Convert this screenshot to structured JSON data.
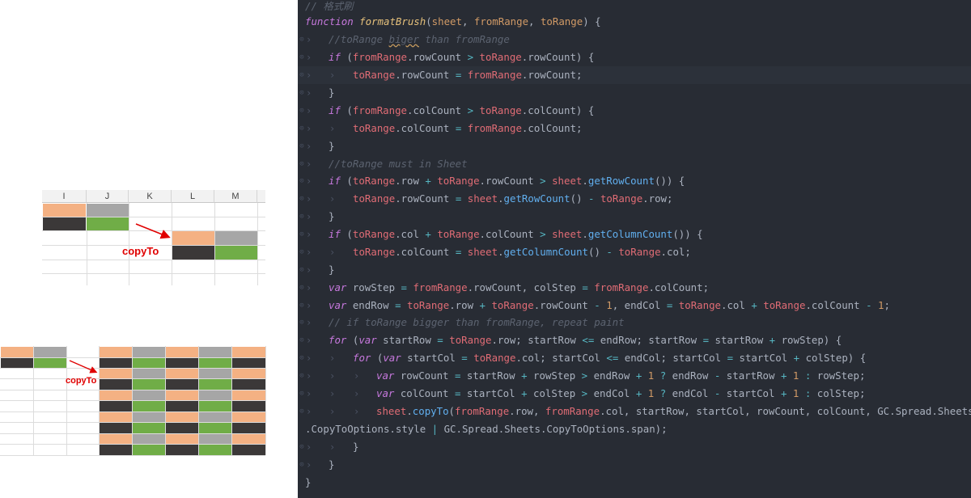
{
  "colors": {
    "orange": "#f4b183",
    "gray": "#a6a6a6",
    "dark": "#3b3838",
    "green": "#70ad47",
    "label_red": "#e00000",
    "editor_bg": "#282c34"
  },
  "illustration": {
    "top_grid": {
      "columns": [
        "I",
        "J",
        "K",
        "L",
        "M"
      ],
      "copy_label": "copyTo"
    },
    "bottom_grid": {
      "copy_label": "copyTo"
    }
  },
  "code": {
    "lines": [
      [
        {
          "t": "cm",
          "v": "// 格式刷"
        }
      ],
      [
        {
          "t": "kw",
          "v": "function "
        },
        {
          "t": "fn",
          "v": "formatBrush"
        },
        {
          "t": "pl",
          "v": "("
        },
        {
          "t": "prm",
          "v": "sheet"
        },
        {
          "t": "pl",
          "v": ", "
        },
        {
          "t": "prm",
          "v": "fromRange"
        },
        {
          "t": "pl",
          "v": ", "
        },
        {
          "t": "prm",
          "v": "toRange"
        },
        {
          "t": "pl",
          "v": ") {"
        }
      ],
      [
        {
          "t": "cm",
          "v": "//toRange "
        },
        {
          "t": "cmw",
          "v": "biger"
        },
        {
          "t": "cm",
          "v": " than fromRange"
        }
      ],
      [
        {
          "t": "kw",
          "v": "if "
        },
        {
          "t": "pl",
          "v": "("
        },
        {
          "t": "var",
          "v": "fromRange"
        },
        {
          "t": "pl",
          "v": ".rowCount "
        },
        {
          "t": "op",
          "v": ">"
        },
        {
          "t": "pl",
          "v": " "
        },
        {
          "t": "var",
          "v": "toRange"
        },
        {
          "t": "pl",
          "v": ".rowCount) {"
        }
      ],
      [
        {
          "t": "var",
          "v": "toRange"
        },
        {
          "t": "pl",
          "v": ".rowCount "
        },
        {
          "t": "op",
          "v": "="
        },
        {
          "t": "pl",
          "v": " "
        },
        {
          "t": "var",
          "v": "fromRange"
        },
        {
          "t": "pl",
          "v": ".rowCount;"
        }
      ],
      [
        {
          "t": "pl",
          "v": "}"
        }
      ],
      [
        {
          "t": "kw",
          "v": "if "
        },
        {
          "t": "pl",
          "v": "("
        },
        {
          "t": "var",
          "v": "fromRange"
        },
        {
          "t": "pl",
          "v": ".colCount "
        },
        {
          "t": "op",
          "v": ">"
        },
        {
          "t": "pl",
          "v": " "
        },
        {
          "t": "var",
          "v": "toRange"
        },
        {
          "t": "pl",
          "v": ".colCount) {"
        }
      ],
      [
        {
          "t": "var",
          "v": "toRange"
        },
        {
          "t": "pl",
          "v": ".colCount "
        },
        {
          "t": "op",
          "v": "="
        },
        {
          "t": "pl",
          "v": " "
        },
        {
          "t": "var",
          "v": "fromRange"
        },
        {
          "t": "pl",
          "v": ".colCount;"
        }
      ],
      [
        {
          "t": "pl",
          "v": "}"
        }
      ],
      [
        {
          "t": "cm",
          "v": "//toRange must in Sheet"
        }
      ],
      [
        {
          "t": "kw",
          "v": "if "
        },
        {
          "t": "pl",
          "v": "("
        },
        {
          "t": "var",
          "v": "toRange"
        },
        {
          "t": "pl",
          "v": ".row "
        },
        {
          "t": "op",
          "v": "+"
        },
        {
          "t": "pl",
          "v": " "
        },
        {
          "t": "var",
          "v": "toRange"
        },
        {
          "t": "pl",
          "v": ".rowCount "
        },
        {
          "t": "op",
          "v": ">"
        },
        {
          "t": "pl",
          "v": " "
        },
        {
          "t": "var",
          "v": "sheet"
        },
        {
          "t": "pl",
          "v": "."
        },
        {
          "t": "fnc",
          "v": "getRowCount"
        },
        {
          "t": "pl",
          "v": "()) {"
        }
      ],
      [
        {
          "t": "var",
          "v": "toRange"
        },
        {
          "t": "pl",
          "v": ".rowCount "
        },
        {
          "t": "op",
          "v": "="
        },
        {
          "t": "pl",
          "v": " "
        },
        {
          "t": "var",
          "v": "sheet"
        },
        {
          "t": "pl",
          "v": "."
        },
        {
          "t": "fnc",
          "v": "getRowCount"
        },
        {
          "t": "pl",
          "v": "() "
        },
        {
          "t": "op",
          "v": "-"
        },
        {
          "t": "pl",
          "v": " "
        },
        {
          "t": "var",
          "v": "toRange"
        },
        {
          "t": "pl",
          "v": ".row;"
        }
      ],
      [
        {
          "t": "pl",
          "v": "}"
        }
      ],
      [
        {
          "t": "kw",
          "v": "if "
        },
        {
          "t": "pl",
          "v": "("
        },
        {
          "t": "var",
          "v": "toRange"
        },
        {
          "t": "pl",
          "v": ".col "
        },
        {
          "t": "op",
          "v": "+"
        },
        {
          "t": "pl",
          "v": " "
        },
        {
          "t": "var",
          "v": "toRange"
        },
        {
          "t": "pl",
          "v": ".colCount "
        },
        {
          "t": "op",
          "v": ">"
        },
        {
          "t": "pl",
          "v": " "
        },
        {
          "t": "var",
          "v": "sheet"
        },
        {
          "t": "pl",
          "v": "."
        },
        {
          "t": "fnc",
          "v": "getColumnCount"
        },
        {
          "t": "pl",
          "v": "()) {"
        }
      ],
      [
        {
          "t": "var",
          "v": "toRange"
        },
        {
          "t": "pl",
          "v": ".colCount "
        },
        {
          "t": "op",
          "v": "="
        },
        {
          "t": "pl",
          "v": " "
        },
        {
          "t": "var",
          "v": "sheet"
        },
        {
          "t": "pl",
          "v": "."
        },
        {
          "t": "fnc",
          "v": "getColumnCount"
        },
        {
          "t": "pl",
          "v": "() "
        },
        {
          "t": "op",
          "v": "-"
        },
        {
          "t": "pl",
          "v": " "
        },
        {
          "t": "var",
          "v": "toRange"
        },
        {
          "t": "pl",
          "v": ".col;"
        }
      ],
      [
        {
          "t": "pl",
          "v": "}"
        }
      ],
      [
        {
          "t": "kw",
          "v": "var "
        },
        {
          "t": "pl",
          "v": "rowStep "
        },
        {
          "t": "op",
          "v": "="
        },
        {
          "t": "pl",
          "v": " "
        },
        {
          "t": "var",
          "v": "fromRange"
        },
        {
          "t": "pl",
          "v": ".rowCount, colStep "
        },
        {
          "t": "op",
          "v": "="
        },
        {
          "t": "pl",
          "v": " "
        },
        {
          "t": "var",
          "v": "fromRange"
        },
        {
          "t": "pl",
          "v": ".colCount;"
        }
      ],
      [
        {
          "t": "kw",
          "v": "var "
        },
        {
          "t": "pl",
          "v": "endRow "
        },
        {
          "t": "op",
          "v": "="
        },
        {
          "t": "pl",
          "v": " "
        },
        {
          "t": "var",
          "v": "toRange"
        },
        {
          "t": "pl",
          "v": ".row "
        },
        {
          "t": "op",
          "v": "+"
        },
        {
          "t": "pl",
          "v": " "
        },
        {
          "t": "var",
          "v": "toRange"
        },
        {
          "t": "pl",
          "v": ".rowCount "
        },
        {
          "t": "op",
          "v": "-"
        },
        {
          "t": "pl",
          "v": " "
        },
        {
          "t": "num",
          "v": "1"
        },
        {
          "t": "pl",
          "v": ", endCol "
        },
        {
          "t": "op",
          "v": "="
        },
        {
          "t": "pl",
          "v": " "
        },
        {
          "t": "var",
          "v": "toRange"
        },
        {
          "t": "pl",
          "v": ".col "
        },
        {
          "t": "op",
          "v": "+"
        },
        {
          "t": "pl",
          "v": " "
        },
        {
          "t": "var",
          "v": "toRange"
        },
        {
          "t": "pl",
          "v": ".colCount "
        },
        {
          "t": "op",
          "v": "-"
        },
        {
          "t": "pl",
          "v": " "
        },
        {
          "t": "num",
          "v": "1"
        },
        {
          "t": "pl",
          "v": ";"
        }
      ],
      [
        {
          "t": "cm",
          "v": "// if toRange bigger than fromRange, repeat paint"
        }
      ],
      [
        {
          "t": "kw",
          "v": "for "
        },
        {
          "t": "pl",
          "v": "("
        },
        {
          "t": "kw",
          "v": "var "
        },
        {
          "t": "pl",
          "v": "startRow "
        },
        {
          "t": "op",
          "v": "="
        },
        {
          "t": "pl",
          "v": " "
        },
        {
          "t": "var",
          "v": "toRange"
        },
        {
          "t": "pl",
          "v": ".row; startRow "
        },
        {
          "t": "op",
          "v": "<="
        },
        {
          "t": "pl",
          "v": " endRow; startRow "
        },
        {
          "t": "op",
          "v": "="
        },
        {
          "t": "pl",
          "v": " startRow "
        },
        {
          "t": "op",
          "v": "+"
        },
        {
          "t": "pl",
          "v": " rowStep) {"
        }
      ],
      [
        {
          "t": "kw",
          "v": "for "
        },
        {
          "t": "pl",
          "v": "("
        },
        {
          "t": "kw",
          "v": "var "
        },
        {
          "t": "pl",
          "v": "startCol "
        },
        {
          "t": "op",
          "v": "="
        },
        {
          "t": "pl",
          "v": " "
        },
        {
          "t": "var",
          "v": "toRange"
        },
        {
          "t": "pl",
          "v": ".col; startCol "
        },
        {
          "t": "op",
          "v": "<="
        },
        {
          "t": "pl",
          "v": " endCol; startCol "
        },
        {
          "t": "op",
          "v": "="
        },
        {
          "t": "pl",
          "v": " startCol "
        },
        {
          "t": "op",
          "v": "+"
        },
        {
          "t": "pl",
          "v": " colStep) {"
        }
      ],
      [
        {
          "t": "kw",
          "v": "var "
        },
        {
          "t": "pl",
          "v": "rowCount "
        },
        {
          "t": "op",
          "v": "="
        },
        {
          "t": "pl",
          "v": " startRow "
        },
        {
          "t": "op",
          "v": "+"
        },
        {
          "t": "pl",
          "v": " rowStep "
        },
        {
          "t": "op",
          "v": ">"
        },
        {
          "t": "pl",
          "v": " endRow "
        },
        {
          "t": "op",
          "v": "+"
        },
        {
          "t": "pl",
          "v": " "
        },
        {
          "t": "num",
          "v": "1"
        },
        {
          "t": "pl",
          "v": " "
        },
        {
          "t": "op",
          "v": "?"
        },
        {
          "t": "pl",
          "v": " endRow "
        },
        {
          "t": "op",
          "v": "-"
        },
        {
          "t": "pl",
          "v": " startRow "
        },
        {
          "t": "op",
          "v": "+"
        },
        {
          "t": "pl",
          "v": " "
        },
        {
          "t": "num",
          "v": "1"
        },
        {
          "t": "pl",
          "v": " "
        },
        {
          "t": "op",
          "v": ":"
        },
        {
          "t": "pl",
          "v": " rowStep;"
        }
      ],
      [
        {
          "t": "kw",
          "v": "var "
        },
        {
          "t": "pl",
          "v": "colCount "
        },
        {
          "t": "op",
          "v": "="
        },
        {
          "t": "pl",
          "v": " startCol "
        },
        {
          "t": "op",
          "v": "+"
        },
        {
          "t": "pl",
          "v": " colStep "
        },
        {
          "t": "op",
          "v": ">"
        },
        {
          "t": "pl",
          "v": " endCol "
        },
        {
          "t": "op",
          "v": "+"
        },
        {
          "t": "pl",
          "v": " "
        },
        {
          "t": "num",
          "v": "1"
        },
        {
          "t": "pl",
          "v": " "
        },
        {
          "t": "op",
          "v": "?"
        },
        {
          "t": "pl",
          "v": " endCol "
        },
        {
          "t": "op",
          "v": "-"
        },
        {
          "t": "pl",
          "v": " startCol "
        },
        {
          "t": "op",
          "v": "+"
        },
        {
          "t": "pl",
          "v": " "
        },
        {
          "t": "num",
          "v": "1"
        },
        {
          "t": "pl",
          "v": " "
        },
        {
          "t": "op",
          "v": ":"
        },
        {
          "t": "pl",
          "v": " colStep;"
        }
      ],
      [
        {
          "t": "var",
          "v": "sheet"
        },
        {
          "t": "pl",
          "v": "."
        },
        {
          "t": "fnc",
          "v": "copyTo"
        },
        {
          "t": "pl",
          "v": "("
        },
        {
          "t": "var",
          "v": "fromRange"
        },
        {
          "t": "pl",
          "v": ".row, "
        },
        {
          "t": "var",
          "v": "fromRange"
        },
        {
          "t": "pl",
          "v": ".col, startRow, startCol, rowCount, colCount, GC.Spread.Sheets"
        }
      ],
      [
        {
          "t": "pl",
          "v": ".CopyToOptions.style "
        },
        {
          "t": "op",
          "v": "|"
        },
        {
          "t": "pl",
          "v": " GC.Spread.Sheets.CopyToOptions.span);"
        }
      ],
      [
        {
          "t": "pl",
          "v": "}"
        }
      ],
      [
        {
          "t": "pl",
          "v": "}"
        }
      ],
      [
        {
          "t": "pl",
          "v": "}"
        }
      ]
    ]
  }
}
